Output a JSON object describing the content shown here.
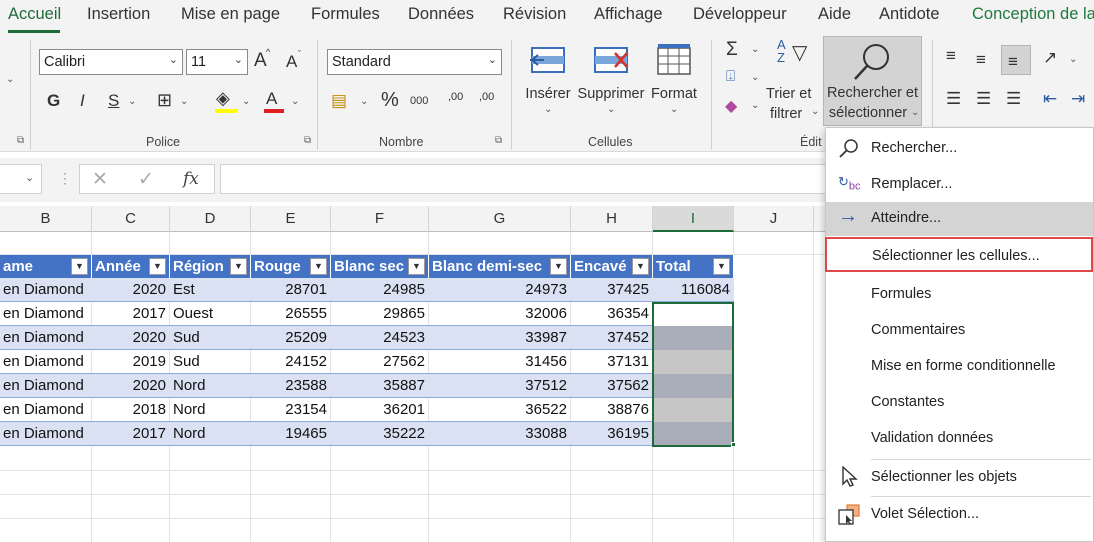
{
  "tabs": [
    "Accueil",
    "Insertion",
    "Mise en page",
    "Formules",
    "Données",
    "Révision",
    "Affichage",
    "Développeur",
    "Aide",
    "Antidote",
    "Conception de la"
  ],
  "font": {
    "name": "Calibri",
    "size": "11",
    "bold": "G",
    "italic": "I",
    "underline": "S",
    "grow": "A",
    "shrink": "A",
    "color_letter": "A"
  },
  "number": {
    "format": "Standard",
    "percent": "%",
    "thousands": "000",
    "inc_decimal": ",00",
    "dec_decimal": ",00"
  },
  "groups": {
    "police": "Police",
    "nombre": "Nombre",
    "cellules": "Cellules",
    "edition": "Édit"
  },
  "cells_buttons": {
    "insert": "Insérer",
    "delete": "Supprimer",
    "format": "Format"
  },
  "edit_buttons": {
    "sort_line1": "Trier et",
    "sort_line2": "filtrer",
    "find_line1": "Rechercher et",
    "find_line2": "sélectionner"
  },
  "formula_bar": {
    "fx": "fx"
  },
  "columns": [
    "B",
    "C",
    "D",
    "E",
    "F",
    "G",
    "H",
    "I",
    "J"
  ],
  "table": {
    "headers": [
      "ame",
      "Année",
      "Région",
      "Rouge",
      "Blanc sec",
      "Blanc demi-sec",
      "Encavé",
      "Total"
    ],
    "rows": [
      [
        "en Diamond",
        "2020",
        "Est",
        "28701",
        "24985",
        "24973",
        "37425",
        "116084"
      ],
      [
        "en Diamond",
        "2017",
        "Ouest",
        "26555",
        "29865",
        "32006",
        "36354",
        ""
      ],
      [
        "en Diamond",
        "2020",
        "Sud",
        "25209",
        "24523",
        "33987",
        "37452",
        ""
      ],
      [
        "en Diamond",
        "2019",
        "Sud",
        "24152",
        "27562",
        "31456",
        "37131",
        ""
      ],
      [
        "en Diamond",
        "2020",
        "Nord",
        "23588",
        "35887",
        "37512",
        "37562",
        ""
      ],
      [
        "en Diamond",
        "2018",
        "Nord",
        "23154",
        "36201",
        "36522",
        "38876",
        ""
      ],
      [
        "en Diamond",
        "2017",
        "Nord",
        "19465",
        "35222",
        "33088",
        "36195",
        ""
      ]
    ]
  },
  "menu": [
    {
      "label": "Rechercher...",
      "icon": "search-icon"
    },
    {
      "label": "Remplacer...",
      "icon": "replace-icon"
    },
    {
      "label": "Atteindre...",
      "icon": "arrow-right-icon"
    },
    {
      "label": "Sélectionner les cellules..."
    },
    {
      "label": "Formules"
    },
    {
      "label": "Commentaires"
    },
    {
      "label": "Mise en forme conditionnelle"
    },
    {
      "label": "Constantes"
    },
    {
      "label": "Validation données"
    },
    {
      "label": "Sélectionner les objets",
      "icon": "pointer-icon"
    },
    {
      "label": "Volet Sélection...",
      "icon": "selection-pane-icon"
    }
  ],
  "colors": {
    "accent": "#1e6b3a",
    "table_header": "#4472c4",
    "table_band": "#d9e1f2",
    "highlight_box": "#e04848"
  }
}
